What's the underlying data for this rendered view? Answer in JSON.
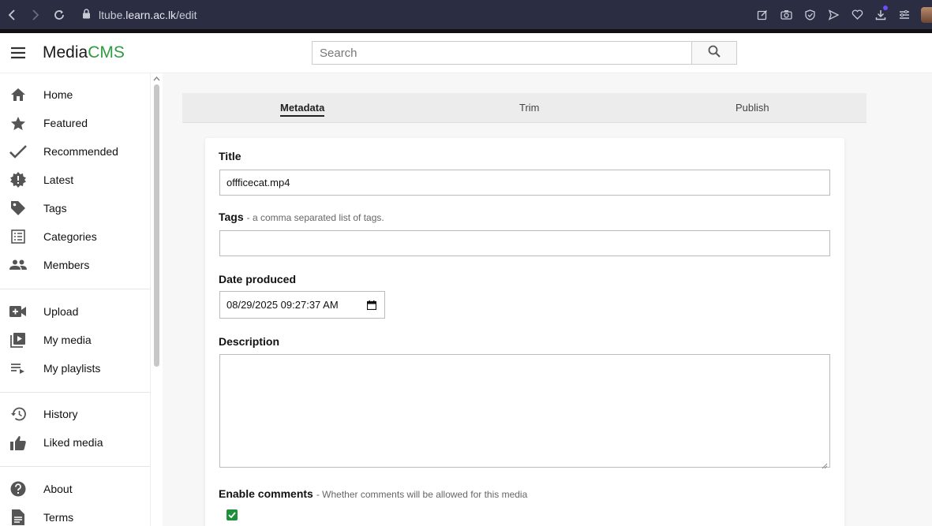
{
  "browser": {
    "url_prefix": "ltube.",
    "url_host": "learn.ac.lk",
    "url_path": "/edit"
  },
  "header": {
    "logo_main": "Media",
    "logo_accent": "CMS",
    "search_placeholder": "Search"
  },
  "sidebar": {
    "items": [
      {
        "label": "Home",
        "icon": "home-icon"
      },
      {
        "label": "Featured",
        "icon": "star-icon"
      },
      {
        "label": "Recommended",
        "icon": "check-icon"
      },
      {
        "label": "Latest",
        "icon": "new-badge-icon"
      },
      {
        "label": "Tags",
        "icon": "tag-icon"
      },
      {
        "label": "Categories",
        "icon": "list-icon"
      },
      {
        "label": "Members",
        "icon": "people-icon"
      },
      {
        "label": "Upload",
        "icon": "video-add-icon"
      },
      {
        "label": "My media",
        "icon": "video-library-icon"
      },
      {
        "label": "My playlists",
        "icon": "playlist-icon"
      },
      {
        "label": "History",
        "icon": "history-icon"
      },
      {
        "label": "Liked media",
        "icon": "thumb-up-icon"
      },
      {
        "label": "About",
        "icon": "help-icon"
      },
      {
        "label": "Terms",
        "icon": "document-icon"
      }
    ]
  },
  "tabs": {
    "metadata": "Metadata",
    "trim": "Trim",
    "publish": "Publish"
  },
  "form": {
    "title_label": "Title",
    "title_value": "offficecat.mp4",
    "tags_label": "Tags",
    "tags_hint": "- a comma separated list of tags.",
    "tags_value": "",
    "date_label": "Date produced",
    "date_value": "08/29/2025 09:27:37 AM",
    "description_label": "Description",
    "comments_label": "Enable comments",
    "comments_hint": "- Whether comments will be allowed for this media",
    "comments_enabled": true
  },
  "colors": {
    "accent": "#2e9b43",
    "browser_bar": "#2b2d42",
    "checkbox": "#1e8f3a"
  }
}
